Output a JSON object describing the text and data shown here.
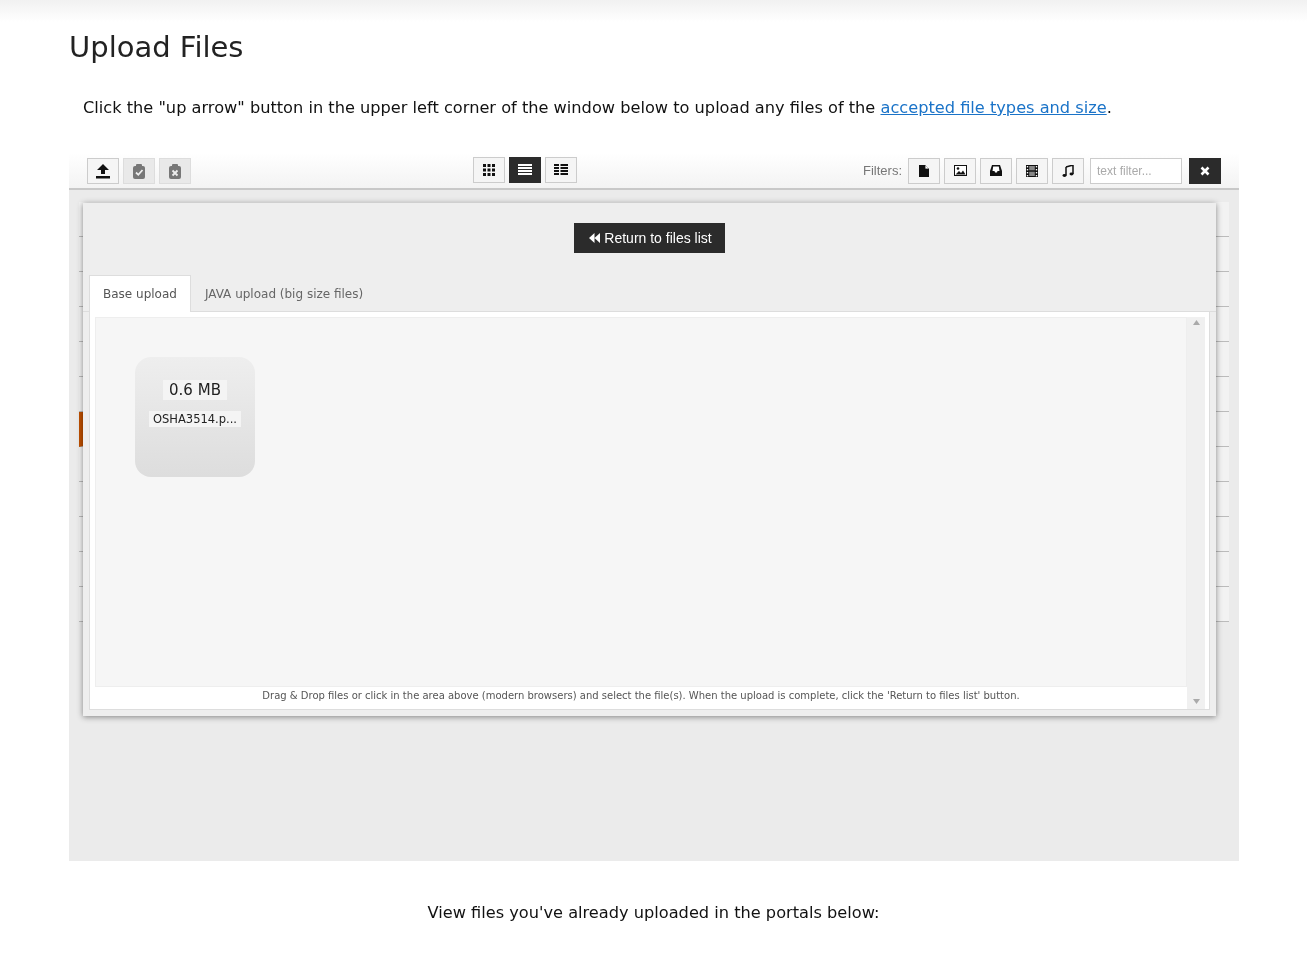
{
  "page": {
    "title": "Upload Files",
    "intro": "Click the \"up arrow\" button in the upper left corner of the window below to upload any files of the ",
    "intro_link": "accepted file types and size",
    "intro_end": "."
  },
  "toolbar": {
    "actions": [
      {
        "kind": "upload",
        "disabled": false
      },
      {
        "kind": "check",
        "disabled": true
      },
      {
        "kind": "delete",
        "disabled": true
      }
    ],
    "views": [
      {
        "kind": "grid",
        "selected": false
      },
      {
        "kind": "list",
        "selected": true
      },
      {
        "kind": "details",
        "selected": false
      }
    ],
    "filters_label": "Filters:",
    "filters": [
      {
        "kind": "file"
      },
      {
        "kind": "image"
      },
      {
        "kind": "archive"
      },
      {
        "kind": "video"
      },
      {
        "kind": "music"
      }
    ],
    "filter_field": {
      "placeholder": "text filter..."
    }
  },
  "dialog": {
    "return_button": "Return to files list",
    "tabs": [
      {
        "label": "Base upload",
        "selected": true
      },
      {
        "label": "JAVA upload (big size files)",
        "selected": false
      }
    ],
    "files": [
      {
        "size": "0.6 MB",
        "name": "OSHA3514.p..."
      }
    ],
    "hint": "Drag & Drop files or click in the area above (modern browsers) and select the file(s). When the upload is complete, click the 'Return to files list' button."
  },
  "footer": "View files you've already uploaded in the portals below:"
}
